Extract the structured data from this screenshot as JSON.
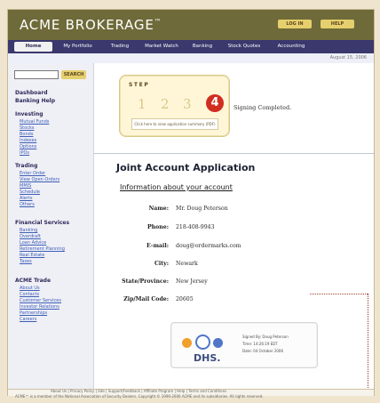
{
  "header": {
    "logo_text": "ACME BROKERAGE",
    "logo_mark": "™",
    "buttons": [
      "LOG IN",
      "HELP"
    ]
  },
  "nav": {
    "tabs": [
      "Home",
      "My Portfolio",
      "Trading",
      "Market Watch",
      "Banking",
      "Stock Quotes",
      "Accounting"
    ]
  },
  "subbar": {
    "date": "August 15, 2006"
  },
  "sidebar": {
    "search_button": "SEARCH",
    "groups": [
      {
        "title": "Dashboard",
        "items": []
      },
      {
        "title": "Banking Help",
        "items": []
      },
      {
        "title": "Investing",
        "items": [
          "Mutual Funds",
          "Stocks",
          "Bonds",
          "Indexes",
          "Options",
          "IPOs"
        ]
      },
      {
        "title": "Trading",
        "items": [
          "Enter Order",
          "View Open Orders",
          "MMIS",
          "Schedule",
          "Alerts",
          "Others"
        ]
      },
      {
        "title": "Financial Services",
        "items": [
          "Banking",
          "Overdraft",
          "Loan Advice",
          "Retirement Planning",
          "Real Estate",
          "Taxes"
        ]
      },
      {
        "title": "ACME Trade",
        "items": [
          "About Us",
          "Contacts",
          "Customer Services",
          "Investor Relations",
          "Partnerships",
          "Careers"
        ]
      }
    ]
  },
  "step": {
    "label": "STEP",
    "numbers": [
      "1",
      "2",
      "3",
      "4"
    ],
    "note": "Click here to view application summary (PDF)"
  },
  "status": {
    "signing_text": "Signing Completed."
  },
  "application": {
    "title": "Joint Account Application",
    "subtitle": "Information about your account",
    "fields": [
      {
        "label": "Name:",
        "value": "Mr. Doug Peterson"
      },
      {
        "label": "Phone:",
        "value": "218-408-9943"
      },
      {
        "label": "E-mail:",
        "value": "doug@ordermarks.com"
      },
      {
        "label": "City:",
        "value": "Newark"
      },
      {
        "label": "State/Province:",
        "value": "New Jersey"
      },
      {
        "label": "Zip/Mail Code:",
        "value": "20605"
      }
    ]
  },
  "signature": {
    "brand": "DHS.",
    "signed_by": "Signed By: Doug Peterson",
    "time": "Time: 14:26:19 EDT",
    "date": "Date: 04 October 2006"
  },
  "footer": {
    "links": "About Us | Privacy Policy | Site | Support/Feedback | Affiliate Program | Help | Terms and Conditions",
    "copyright": "ACME™ is a member of the National Association of Security Dealers. Copyright © 1999-2006 ACME and its subsidiaries. All rights reserved."
  },
  "colors": {
    "header": "#6e6a39",
    "nav": "#3a386d",
    "accent": "#e6cf6d",
    "step_active": "#d22d21",
    "sig_blue": "#4f76c9",
    "sig_orange": "#f0a02b"
  },
  "icons": {
    "signature": "dhs-logo-icon"
  }
}
